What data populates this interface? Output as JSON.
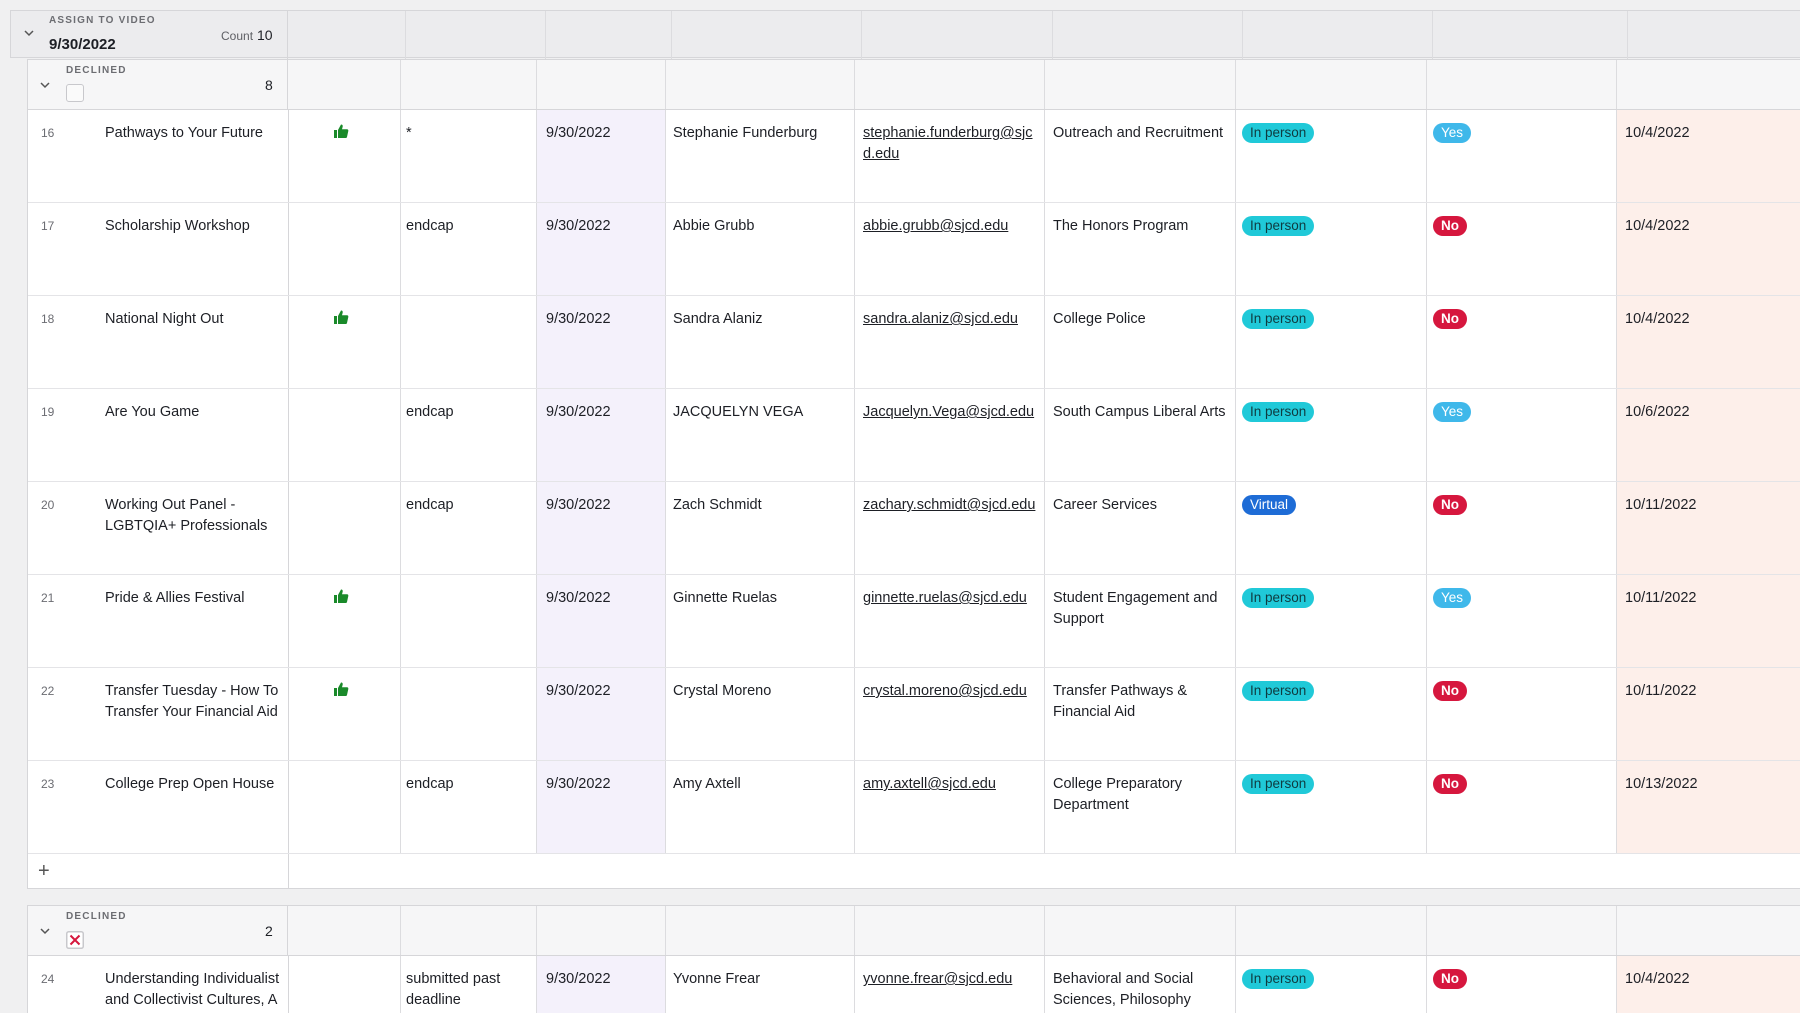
{
  "outer_group": {
    "label": "ASSIGN TO VIDEO",
    "value": "9/30/2022",
    "count_label": "Count",
    "count": "10"
  },
  "group1": {
    "label": "DECLINED",
    "count": "8"
  },
  "group2": {
    "label": "DECLINED",
    "count": "2"
  },
  "rows": [
    {
      "num": "16",
      "event": "Pathways to Your Future",
      "thumb": true,
      "note": "*",
      "date": "9/30/2022",
      "name": "Stephanie Funderburg",
      "email": "stephanie.funderburg@sjcd.edu",
      "dept": "Outreach and Recruitment",
      "mode": "In person",
      "answer": "Yes",
      "event_date": "10/4/2022"
    },
    {
      "num": "17",
      "event": "Scholarship Workshop",
      "thumb": false,
      "note": "endcap",
      "date": "9/30/2022",
      "name": "Abbie Grubb",
      "email": "abbie.grubb@sjcd.edu",
      "dept": "The Honors Program",
      "mode": "In person",
      "answer": "No",
      "event_date": "10/4/2022"
    },
    {
      "num": "18",
      "event": "National Night Out",
      "thumb": true,
      "note": "",
      "date": "9/30/2022",
      "name": "Sandra Alaniz",
      "email": "sandra.alaniz@sjcd.edu",
      "dept": "College Police",
      "mode": "In person",
      "answer": "No",
      "event_date": "10/4/2022"
    },
    {
      "num": "19",
      "event": "Are You Game",
      "thumb": false,
      "note": "endcap",
      "date": "9/30/2022",
      "name": "JACQUELYN VEGA",
      "email": "Jacquelyn.Vega@sjcd.edu",
      "dept": "South Campus Liberal Arts",
      "mode": "In person",
      "answer": "Yes",
      "event_date": "10/6/2022"
    },
    {
      "num": "20",
      "event": "Working Out Panel - LGBTQIA+ Professionals",
      "thumb": false,
      "note": "endcap",
      "date": "9/30/2022",
      "name": "Zach Schmidt",
      "email": "zachary.schmidt@sjcd.edu",
      "dept": "Career Services",
      "mode": "Virtual",
      "answer": "No",
      "event_date": "10/11/2022"
    },
    {
      "num": "21",
      "event": "Pride & Allies Festival",
      "thumb": true,
      "note": "",
      "date": "9/30/2022",
      "name": "Ginnette Ruelas",
      "email": "ginnette.ruelas@sjcd.edu",
      "dept": "Student Engagement and Support",
      "mode": "In person",
      "answer": "Yes",
      "event_date": "10/11/2022"
    },
    {
      "num": "22",
      "event": "Transfer Tuesday - How To Transfer Your Financial Aid",
      "thumb": true,
      "note": "",
      "date": "9/30/2022",
      "name": "Crystal Moreno",
      "email": "crystal.moreno@sjcd.edu",
      "dept": "Transfer Pathways & Financial Aid",
      "mode": "In person",
      "answer": "No",
      "event_date": "10/11/2022"
    },
    {
      "num": "23",
      "event": "College Prep Open House",
      "thumb": false,
      "note": "endcap",
      "date": "9/30/2022",
      "name": "Amy Axtell",
      "email": "amy.axtell@sjcd.edu",
      "dept": "College Preparatory Department",
      "mode": "In person",
      "answer": "No",
      "event_date": "10/13/2022"
    }
  ],
  "row24": {
    "num": "24",
    "event": "Understanding Individualist and Collectivist Cultures, A Cross-Cultural",
    "note": "submitted past deadline",
    "date": "9/30/2022",
    "name": "Yvonne Frear",
    "email": "yvonne.frear@sjcd.edu",
    "dept": "Behavioral and Social Sciences, Philosophy department at SJC Central",
    "mode": "In person",
    "answer": "No",
    "event_date": "10/4/2022"
  },
  "add_row_label": "+",
  "colors": {
    "in_person": "#20c9d8",
    "virtual": "#1e6cd6",
    "yes": "#3fb8ea",
    "no": "#d6173e",
    "thumb": "#1a8a2a"
  }
}
